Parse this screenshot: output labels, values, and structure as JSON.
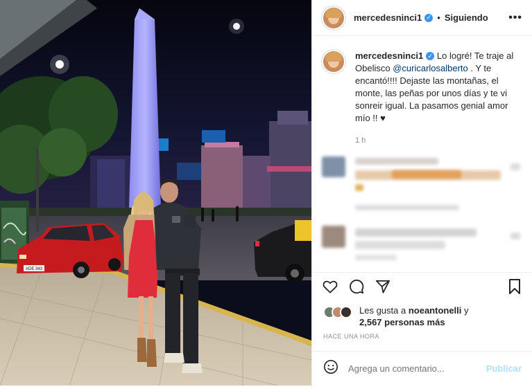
{
  "post": {
    "username": "mercedesninci1",
    "follow_status": "Siguiendo",
    "more_label": "•••",
    "caption": {
      "username": "mercedesninci1",
      "text_1": " Lo logré! Te traje al Obelisco ",
      "mention": "@curicarlosalberto",
      "text_2": " . Y te encantó!!!! Dejaste las montañas, el monte, las peñas por unos días y te vi sonreir igual. La pasamos genial amor mío !! ",
      "heart": "♥",
      "time": "1 h"
    },
    "likes": {
      "prefix": "Les gusta a ",
      "user": "noeantonelli",
      "middle": " y",
      "count": "2,567 personas más"
    },
    "posted_ago": "HACE UNA HORA",
    "comment_placeholder": "Agrega un comentario...",
    "publish_label": "Publicar"
  },
  "photo": {
    "plate_text": "ADE 343"
  },
  "icons": {
    "header_avatar": "profile-avatar",
    "verified": "verified-badge-icon",
    "like": "heart-icon",
    "comment": "comment-icon",
    "share": "share-icon",
    "save": "bookmark-icon",
    "emoji": "emoji-icon"
  },
  "colors": {
    "accent_blue": "#3897f0",
    "publish_disabled": "#b2dffc",
    "muted_text": "#8e8e8e"
  }
}
